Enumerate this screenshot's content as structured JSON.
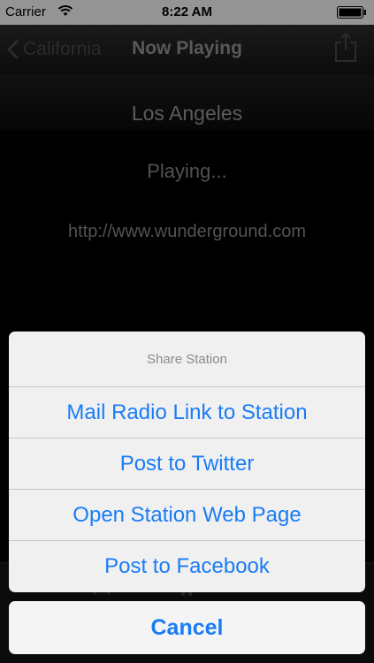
{
  "status_bar": {
    "carrier": "Carrier",
    "time": "8:22 AM"
  },
  "nav": {
    "back_label": "California",
    "title": "Now Playing"
  },
  "station": {
    "name": "Los Angeles",
    "status": "Playing...",
    "url": "http://www.wunderground.com"
  },
  "action_sheet": {
    "title": "Share Station",
    "options": [
      "Mail Radio Link to Station",
      "Post to Twitter",
      "Open Station Web Page",
      "Post to Facebook"
    ],
    "cancel": "Cancel"
  },
  "colors": {
    "accent": "#1a7cf5",
    "sheet_background": "#f0f0f0",
    "page_background": "#000000"
  }
}
